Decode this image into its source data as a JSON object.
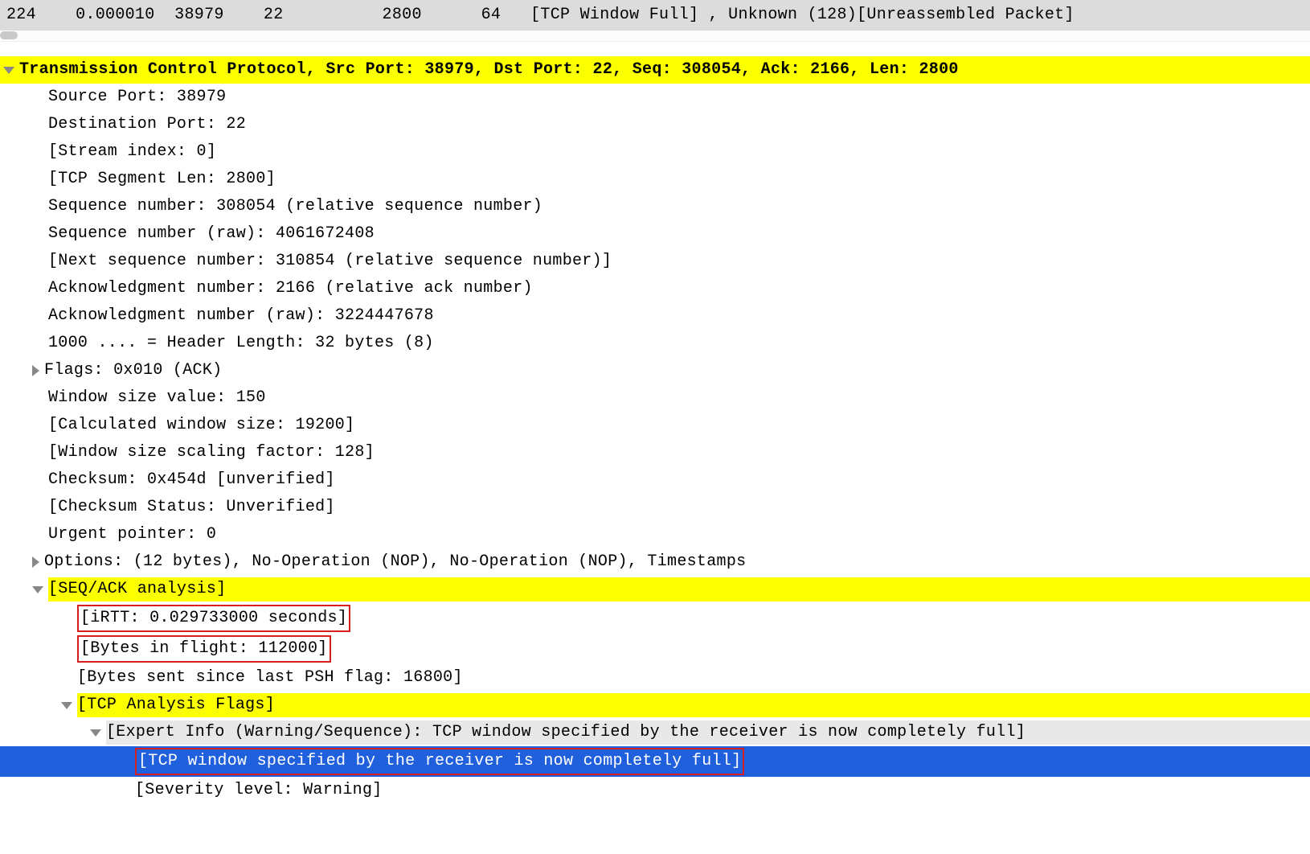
{
  "packet_row": {
    "no": "224",
    "time": "0.000010",
    "src_port": "38979",
    "dst_port": "22",
    "len": "2800",
    "win": "64",
    "info": "[TCP Window Full] , Unknown (128)[Unreassembled Packet]"
  },
  "tcp": {
    "header": "Transmission Control Protocol, Src Port: 38979, Dst Port: 22, Seq: 308054, Ack: 2166, Len: 2800",
    "src_port": "Source Port: 38979",
    "dst_port": "Destination Port: 22",
    "stream_index": "[Stream index: 0]",
    "segment_len": "[TCP Segment Len: 2800]",
    "seq_rel": "Sequence number: 308054    (relative sequence number)",
    "seq_raw": "Sequence number (raw): 4061672408",
    "next_seq": "[Next sequence number: 310854    (relative sequence number)]",
    "ack_rel": "Acknowledgment number: 2166    (relative ack number)",
    "ack_raw": "Acknowledgment number (raw): 3224447678",
    "hdr_len": "1000 .... = Header Length: 32 bytes (8)",
    "flags": "Flags: 0x010 (ACK)",
    "win_size_value": "Window size value: 150",
    "calc_win_size": "[Calculated window size: 19200]",
    "win_scale": "[Window size scaling factor: 128]",
    "checksum": "Checksum: 0x454d [unverified]",
    "checksum_status": "[Checksum Status: Unverified]",
    "urgent": "Urgent pointer: 0",
    "options": "Options: (12 bytes), No-Operation (NOP), No-Operation (NOP), Timestamps",
    "seqack": {
      "header": "[SEQ/ACK analysis]",
      "irtt": "[iRTT: 0.029733000 seconds]",
      "bytes_in_flight": "[Bytes in flight: 112000]",
      "bytes_since_psh": "[Bytes sent since last PSH flag: 16800]",
      "tcp_analysis_flags": {
        "header": "[TCP Analysis Flags]",
        "expert_info": "[Expert Info (Warning/Sequence): TCP window specified by the receiver is now completely full]",
        "message": "[TCP window specified by the receiver is now completely full]",
        "severity": "[Severity level: Warning]"
      }
    }
  }
}
